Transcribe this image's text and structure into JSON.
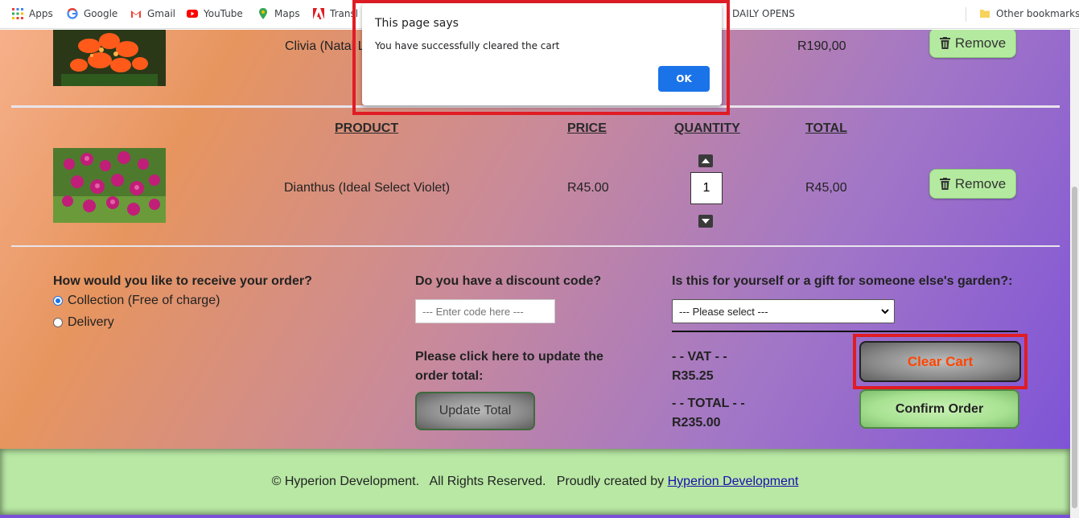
{
  "bookmarks": {
    "items": [
      {
        "label": "Apps",
        "icon": "apps-grid-icon"
      },
      {
        "label": "Google",
        "icon": "google-icon"
      },
      {
        "label": "Gmail",
        "icon": "gmail-icon"
      },
      {
        "label": "YouTube",
        "icon": "youtube-icon"
      },
      {
        "label": "Maps",
        "icon": "maps-icon"
      },
      {
        "label": "Transl",
        "icon": "adobe-icon"
      },
      {
        "label": "DAILY OPENS",
        "icon": ""
      },
      {
        "label": "Other bookmarks",
        "icon": "folder-icon"
      }
    ]
  },
  "cart": {
    "row1": {
      "name": "Clivia (Natal L",
      "total": "R190,00",
      "remove_label": "Remove"
    },
    "headers": {
      "product": "PRODUCT",
      "price": "PRICE",
      "quantity": "QUANTITY",
      "total": "TOTAL"
    },
    "row2": {
      "name": "Dianthus (Ideal Select Violet)",
      "price": "R45.00",
      "quantity": "1",
      "total": "R45,00",
      "remove_label": "Remove"
    }
  },
  "order": {
    "receive_question": "How would you like to receive your order?",
    "options": [
      {
        "label": "Collection (Free of charge)",
        "checked": true
      },
      {
        "label": "Delivery",
        "checked": false
      }
    ],
    "discount_question": "Do you have a discount code?",
    "discount_placeholder": "--- Enter code here ---",
    "gift_question": "Is this for yourself or a gift for someone else's garden?:",
    "gift_selected": "--- Please select ---",
    "update_prompt_line1": "Please click here to update the",
    "update_prompt_line2": "order total:",
    "update_button": "Update Total",
    "vat_label": "- - VAT - -",
    "vat_value": "R35.25",
    "total_label": "- - TOTAL - -",
    "total_value": "R235.00",
    "clear_cart": "Clear Cart",
    "confirm_order": "Confirm Order"
  },
  "footer": {
    "text": "© Hyperion Development.   All Rights Reserved.   Proudly created by ",
    "link": "Hyperion Development"
  },
  "dialog": {
    "title": "This page says",
    "message": "You have successfully cleared the cart",
    "ok": "OK"
  },
  "colors": {
    "highlight": "#e01c24",
    "clear_cart_text": "#ff4500",
    "ok_button": "#1a73e8"
  }
}
